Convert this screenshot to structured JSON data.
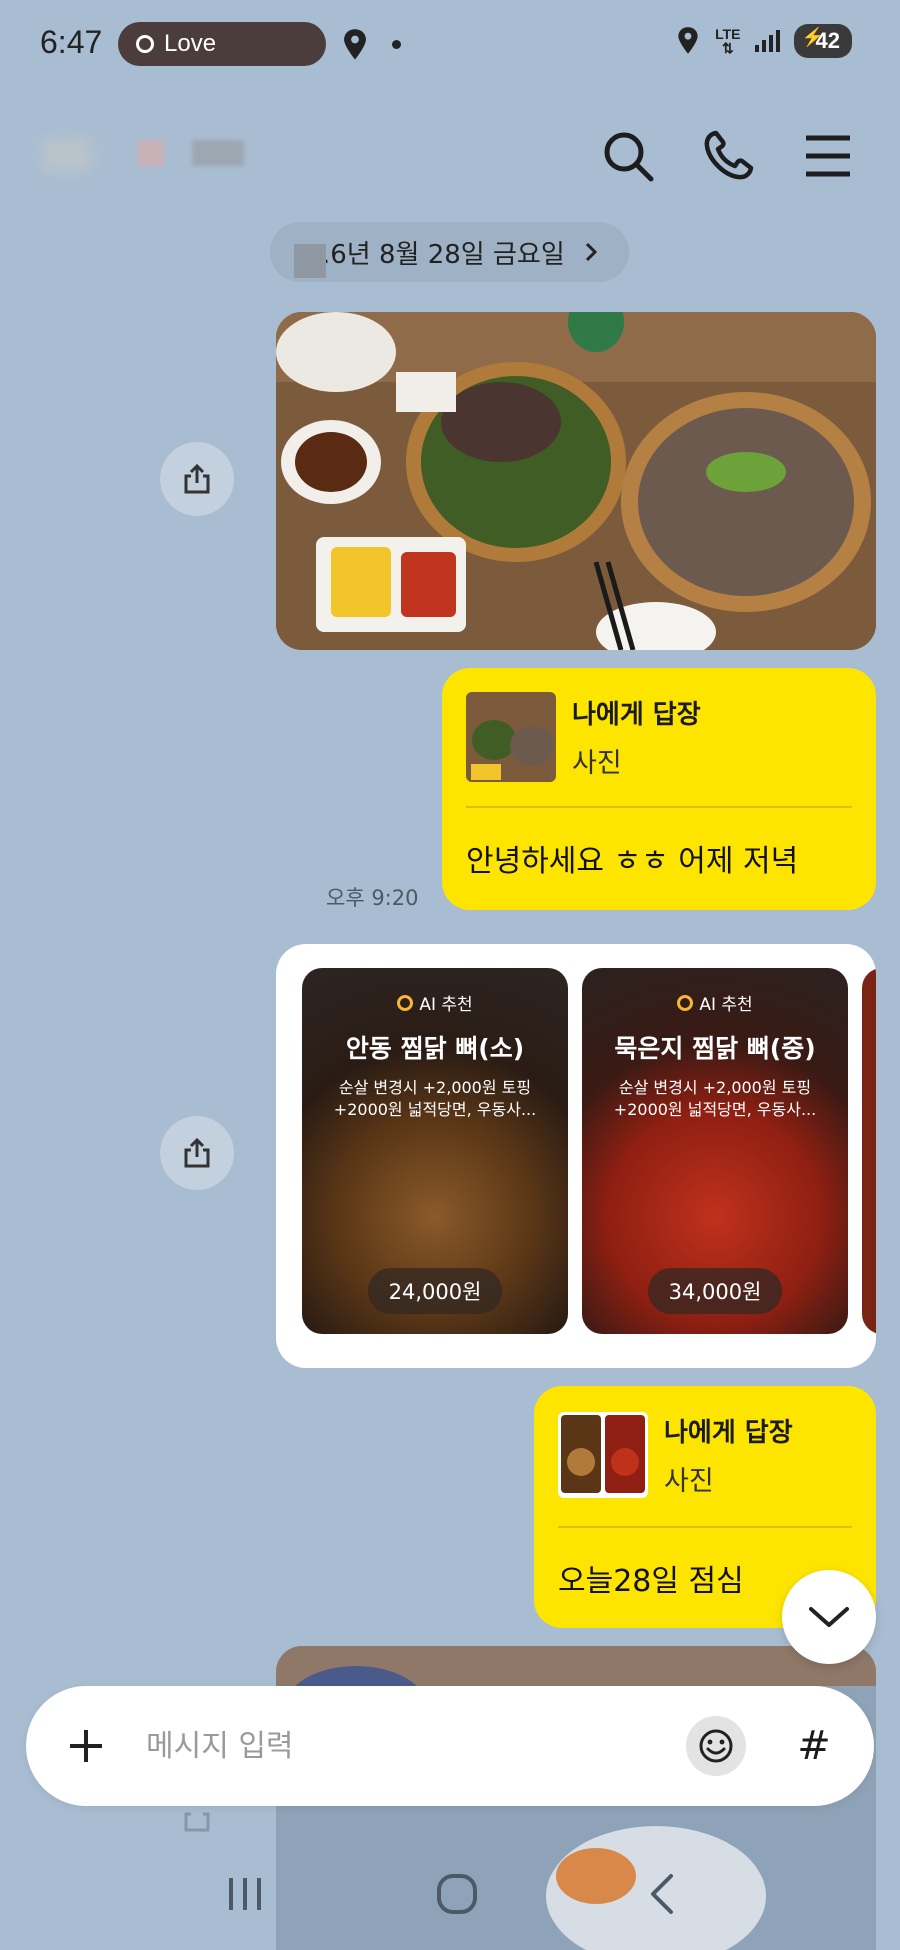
{
  "status_bar": {
    "time": "6:47",
    "music_pill": "Love",
    "network": "LTE",
    "battery": "42"
  },
  "chat": {
    "date_divider": ".6년 8월 28일 금요일",
    "messages": [
      {
        "type": "reply",
        "reply_title": "나에게 답장",
        "reply_sub": "사진",
        "text": "안녕하세요 ㅎㅎ 어제 저녁",
        "time": "오후 9:20"
      },
      {
        "type": "reply",
        "reply_title": "나에게 답장",
        "reply_sub": "사진",
        "text": "오늘28일 점심"
      }
    ],
    "cards": [
      {
        "badge": "AI 추천",
        "name": "안동 찜닭 뼈(소)",
        "desc": "순살 변경시 +2,000원 토핑 +2000원 넓적당면, 우동사...",
        "price": "24,000원"
      },
      {
        "badge": "AI 추천",
        "name": "묵은지 찜닭 뼈(중)",
        "desc": "순살 변경시 +2,000원 토핑 +2000원 넓적당면, 우동사...",
        "price": "34,000원"
      }
    ]
  },
  "input": {
    "placeholder": "메시지 입력",
    "hash_label": "#"
  },
  "colors": {
    "background": "#a9bdd2",
    "bubble_yellow": "#fee500"
  }
}
